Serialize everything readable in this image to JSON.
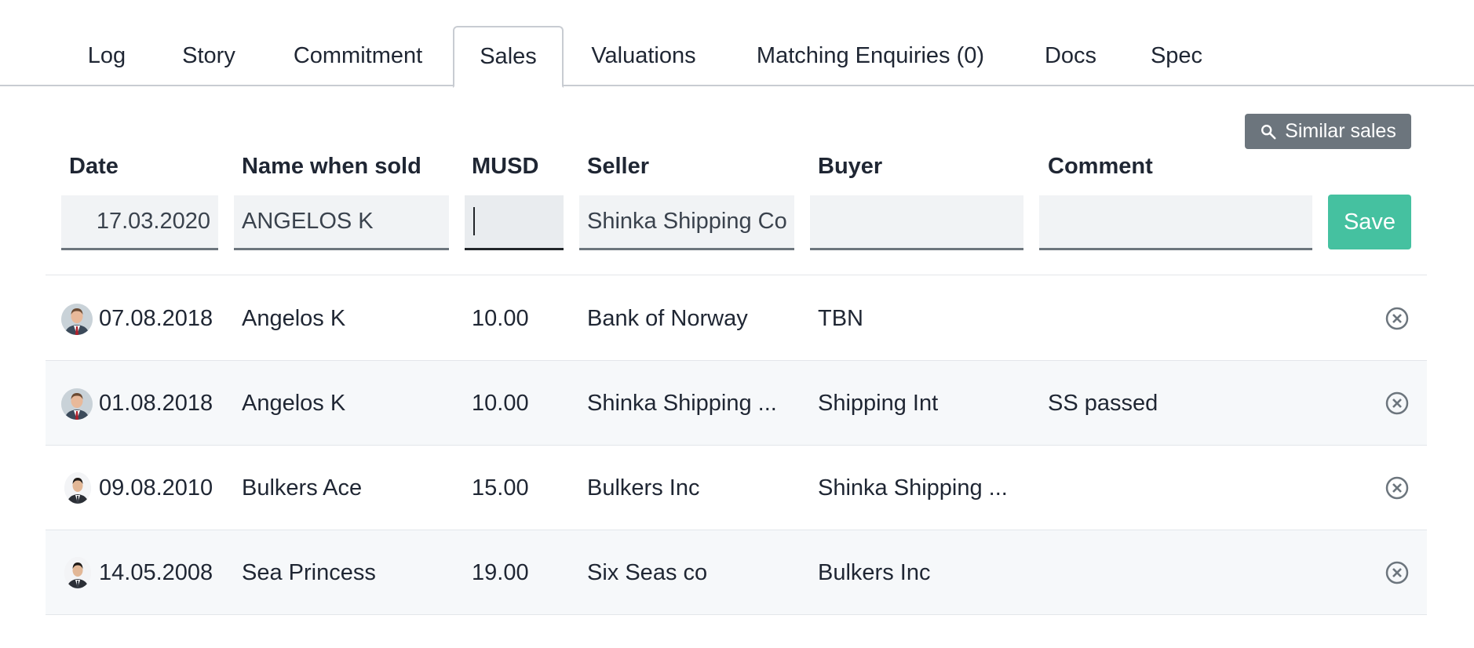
{
  "tabs": [
    {
      "label": "Log",
      "active": false
    },
    {
      "label": "Story",
      "active": false
    },
    {
      "label": "Commitment",
      "active": false
    },
    {
      "label": "Sales",
      "active": true
    },
    {
      "label": "Valuations",
      "active": false
    },
    {
      "label": "Matching Enquiries (0)",
      "active": false
    },
    {
      "label": "Docs",
      "active": false
    },
    {
      "label": "Spec",
      "active": false
    }
  ],
  "toolbar": {
    "similar_sales_label": "Similar sales",
    "similar_sales_icon": "search-icon"
  },
  "columns": {
    "date": "Date",
    "name": "Name when sold",
    "musd": "MUSD",
    "seller": "Seller",
    "buyer": "Buyer",
    "comment": "Comment"
  },
  "form": {
    "date_value": "17.03.2020",
    "name_value": "ANGELOS K",
    "musd_value": "",
    "seller_value": "Shinka Shipping Co",
    "buyer_value": "",
    "comment_value": "",
    "save_label": "Save"
  },
  "rows": [
    {
      "date": "07.08.2018",
      "name": "Angelos K",
      "musd": "10.00",
      "seller": "Bank of Norway",
      "buyer": "TBN",
      "comment": "",
      "avatar": "avatar-man-red-tie"
    },
    {
      "date": "01.08.2018",
      "name": "Angelos K",
      "musd": "10.00",
      "seller": "Shinka Shipping ...",
      "buyer": "Shipping Int",
      "comment": "SS passed",
      "avatar": "avatar-man-red-tie"
    },
    {
      "date": "09.08.2010",
      "name": "Bulkers Ace",
      "musd": "15.00",
      "seller": "Bulkers Inc",
      "buyer": "Shinka Shipping ...",
      "comment": "",
      "avatar": "avatar-man-dark-suit"
    },
    {
      "date": "14.05.2008",
      "name": "Sea Princess",
      "musd": "19.00",
      "seller": "Six Seas co",
      "buyer": "Bulkers Inc",
      "comment": "",
      "avatar": "avatar-man-dark-suit"
    }
  ],
  "colors": {
    "save_button": "#45c1a0",
    "similar_button": "#6c757d",
    "row_alt": "#f6f8fa"
  }
}
